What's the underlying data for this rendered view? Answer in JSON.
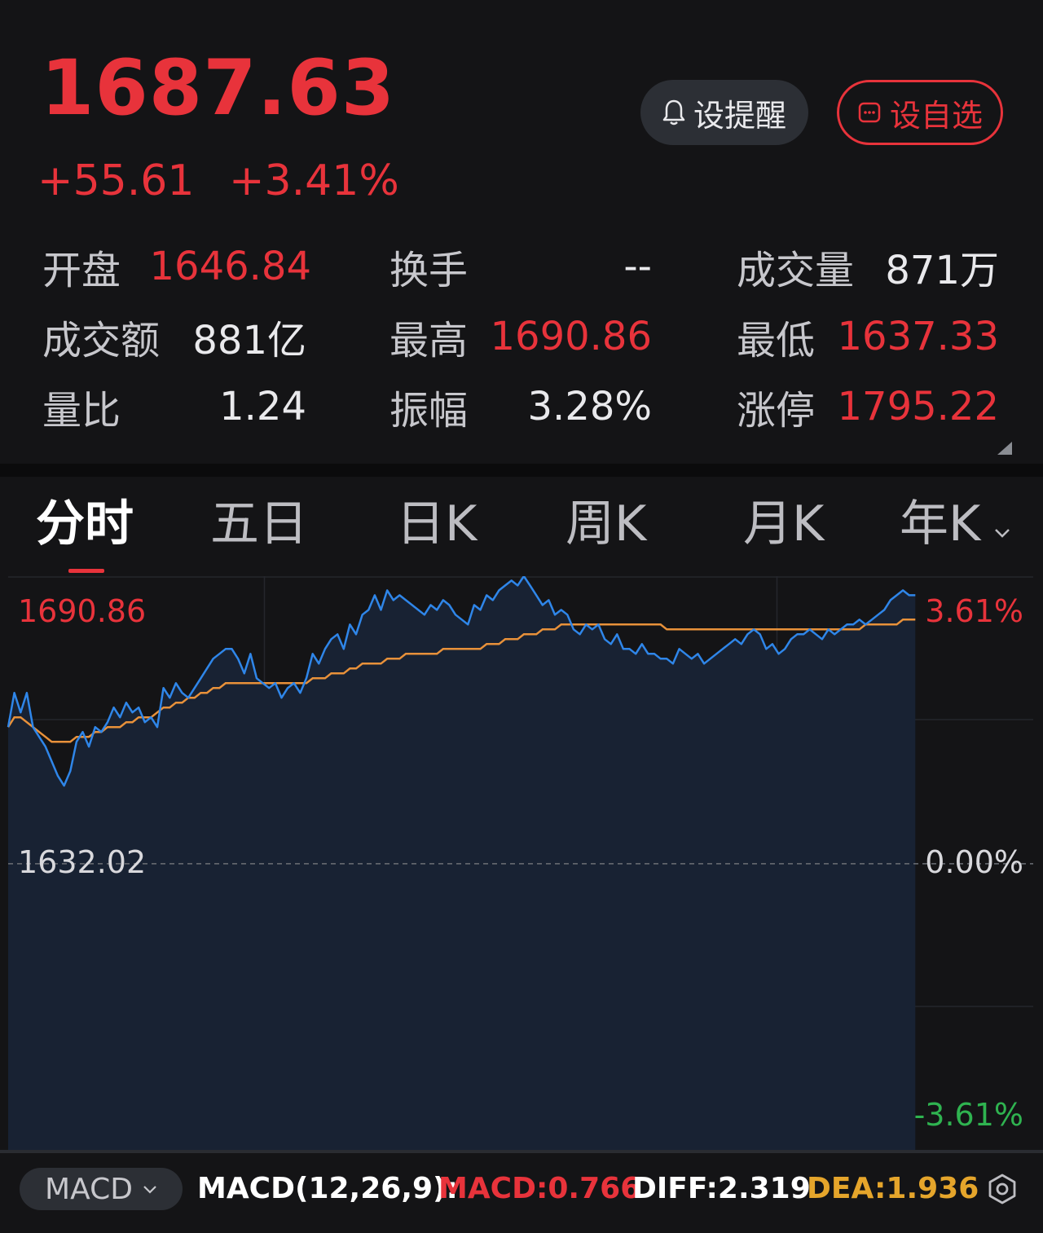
{
  "quote": {
    "price": "1687.63",
    "change": "+55.61",
    "change_pct": "+3.41%"
  },
  "buttons": {
    "alert_label": "设提醒",
    "watchlist_label": "设自选"
  },
  "stats": [
    {
      "label": "开盘",
      "value": "1646.84",
      "color": "red"
    },
    {
      "label": "换手",
      "value": "--",
      "color": "white"
    },
    {
      "label": "成交量",
      "value": "871万",
      "color": "white"
    },
    {
      "label": "成交额",
      "value": "881亿",
      "color": "white"
    },
    {
      "label": "最高",
      "value": "1690.86",
      "color": "red"
    },
    {
      "label": "最低",
      "value": "1637.33",
      "color": "red"
    },
    {
      "label": "量比",
      "value": "1.24",
      "color": "white"
    },
    {
      "label": "振幅",
      "value": "3.28%",
      "color": "white"
    },
    {
      "label": "涨停",
      "value": "1795.22",
      "color": "red"
    }
  ],
  "tabs": [
    {
      "label": "分时",
      "active": true
    },
    {
      "label": "五日",
      "active": false
    },
    {
      "label": "日K",
      "active": false
    },
    {
      "label": "周K",
      "active": false
    },
    {
      "label": "月K",
      "active": false
    },
    {
      "label": "年K",
      "active": false
    }
  ],
  "chart_data": {
    "type": "line",
    "price_high_label": "1690.86",
    "base_price_label": "1632.02",
    "pct_high_label": "3.61%",
    "pct_zero_label": "0.00%",
    "pct_low_label": "-3.61%",
    "base_price": 1632.02,
    "ylim": [
      1573.1,
      1690.9
    ],
    "x_fraction_elapsed": 0.885,
    "grid": true,
    "series": [
      {
        "values": [
          1660,
          1667,
          1663,
          1667,
          1660,
          1658,
          1656,
          1653,
          1650,
          1648,
          1651,
          1657,
          1659,
          1656,
          1660,
          1659,
          1661,
          1664,
          1662,
          1665,
          1663,
          1664,
          1661,
          1662,
          1660,
          1668,
          1666,
          1669,
          1667,
          1666,
          1668,
          1670,
          1672,
          1674,
          1675,
          1676,
          1676,
          1674,
          1671,
          1675,
          1670,
          1669,
          1668,
          1669,
          1666,
          1668,
          1669,
          1667,
          1670,
          1675,
          1673,
          1676,
          1678,
          1679,
          1676,
          1681,
          1679,
          1683,
          1684,
          1687,
          1684,
          1688,
          1686,
          1687,
          1686,
          1685,
          1684,
          1683,
          1685,
          1684,
          1686,
          1685,
          1683,
          1682,
          1681,
          1685,
          1684,
          1687,
          1686,
          1688,
          1689,
          1690,
          1689,
          1690.9,
          1689,
          1687,
          1685,
          1686,
          1683,
          1684,
          1683,
          1680,
          1679,
          1681,
          1680,
          1681,
          1678,
          1677,
          1679,
          1676,
          1676,
          1675,
          1677,
          1675,
          1675,
          1674,
          1674,
          1673,
          1676,
          1675,
          1674,
          1675,
          1673,
          1674,
          1675,
          1676,
          1677,
          1678,
          1677,
          1679,
          1680,
          1679,
          1676,
          1677,
          1675,
          1676,
          1678,
          1679,
          1679,
          1680,
          1679,
          1678,
          1680,
          1679,
          1680,
          1681,
          1681,
          1682,
          1681,
          1682,
          1683,
          1684,
          1686,
          1687,
          1688,
          1687,
          1687
        ]
      },
      {
        "values": [
          1660,
          1662,
          1662,
          1661,
          1660,
          1659,
          1658,
          1657,
          1657,
          1657,
          1657,
          1658,
          1658,
          1658,
          1659,
          1659,
          1660,
          1660,
          1660,
          1661,
          1661,
          1662,
          1662,
          1662,
          1663,
          1664,
          1664,
          1665,
          1665,
          1666,
          1666,
          1667,
          1667,
          1668,
          1668,
          1669,
          1669,
          1669,
          1669,
          1669,
          1669,
          1669,
          1669,
          1669,
          1669,
          1669,
          1669,
          1669,
          1669,
          1670,
          1670,
          1670,
          1671,
          1671,
          1671,
          1672,
          1672,
          1673,
          1673,
          1673,
          1673,
          1674,
          1674,
          1674,
          1675,
          1675,
          1675,
          1675,
          1675,
          1675,
          1676,
          1676,
          1676,
          1676,
          1676,
          1676,
          1676,
          1677,
          1677,
          1677,
          1678,
          1678,
          1678,
          1679,
          1679,
          1679,
          1680,
          1680,
          1680,
          1681,
          1681,
          1681,
          1681,
          1681,
          1681,
          1681,
          1681,
          1681,
          1681,
          1681,
          1681,
          1681,
          1681,
          1681,
          1681,
          1681,
          1680,
          1680,
          1680,
          1680,
          1680,
          1680,
          1680,
          1680,
          1680,
          1680,
          1680,
          1680,
          1680,
          1680,
          1680,
          1680,
          1680,
          1680,
          1680,
          1680,
          1680,
          1680,
          1680,
          1680,
          1680,
          1680,
          1680,
          1680,
          1680,
          1680,
          1680,
          1680,
          1681,
          1681,
          1681,
          1681,
          1681,
          1681,
          1682,
          1682,
          1682
        ]
      }
    ],
    "colors": {
      "price": "#2f86e9",
      "avg": "#e8913a",
      "up": "#e8333b",
      "down": "#2fb350"
    }
  },
  "indicator": {
    "selected": "MACD",
    "params": "MACD(12,26,9):",
    "macd": "MACD:0.766",
    "diff": "DIFF:2.319",
    "dea": "DEA:1.936"
  }
}
